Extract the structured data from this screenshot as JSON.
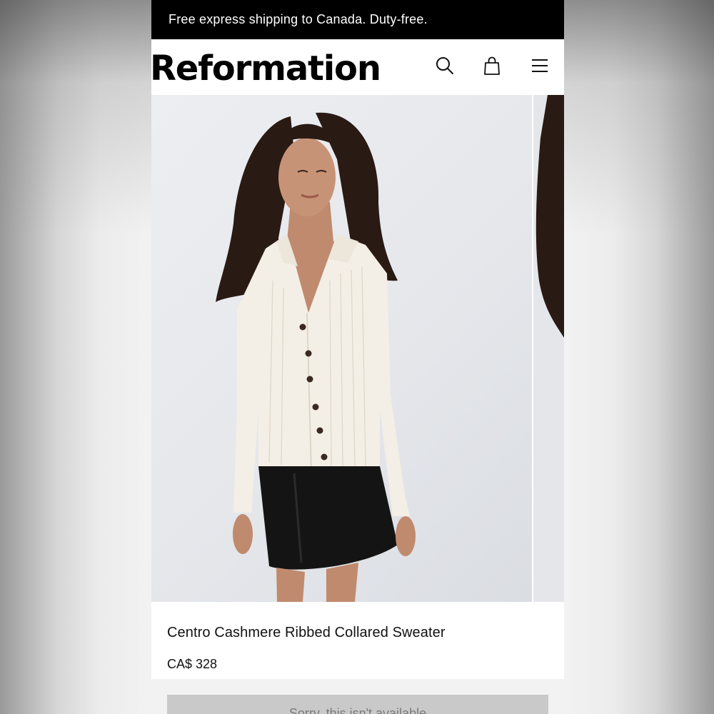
{
  "promo": {
    "text": "Free express shipping to Canada. Duty-free."
  },
  "header": {
    "logo": "Reformation",
    "icons": [
      "search-icon",
      "shopping-bag-icon",
      "hamburger-menu-icon"
    ]
  },
  "gallery": {
    "images": [
      {
        "description_icon": "product-photo"
      },
      {
        "description_icon": "product-photo-next"
      }
    ]
  },
  "product": {
    "name": "Centro Cashmere Ribbed Collared Sweater",
    "price": "CA$ 328"
  },
  "cta": {
    "label": "Sorry, this isn't available"
  },
  "colors": {
    "promo_bg": "#000000",
    "header_bg": "#ffffff",
    "button_disabled": "#c9c9c9"
  }
}
